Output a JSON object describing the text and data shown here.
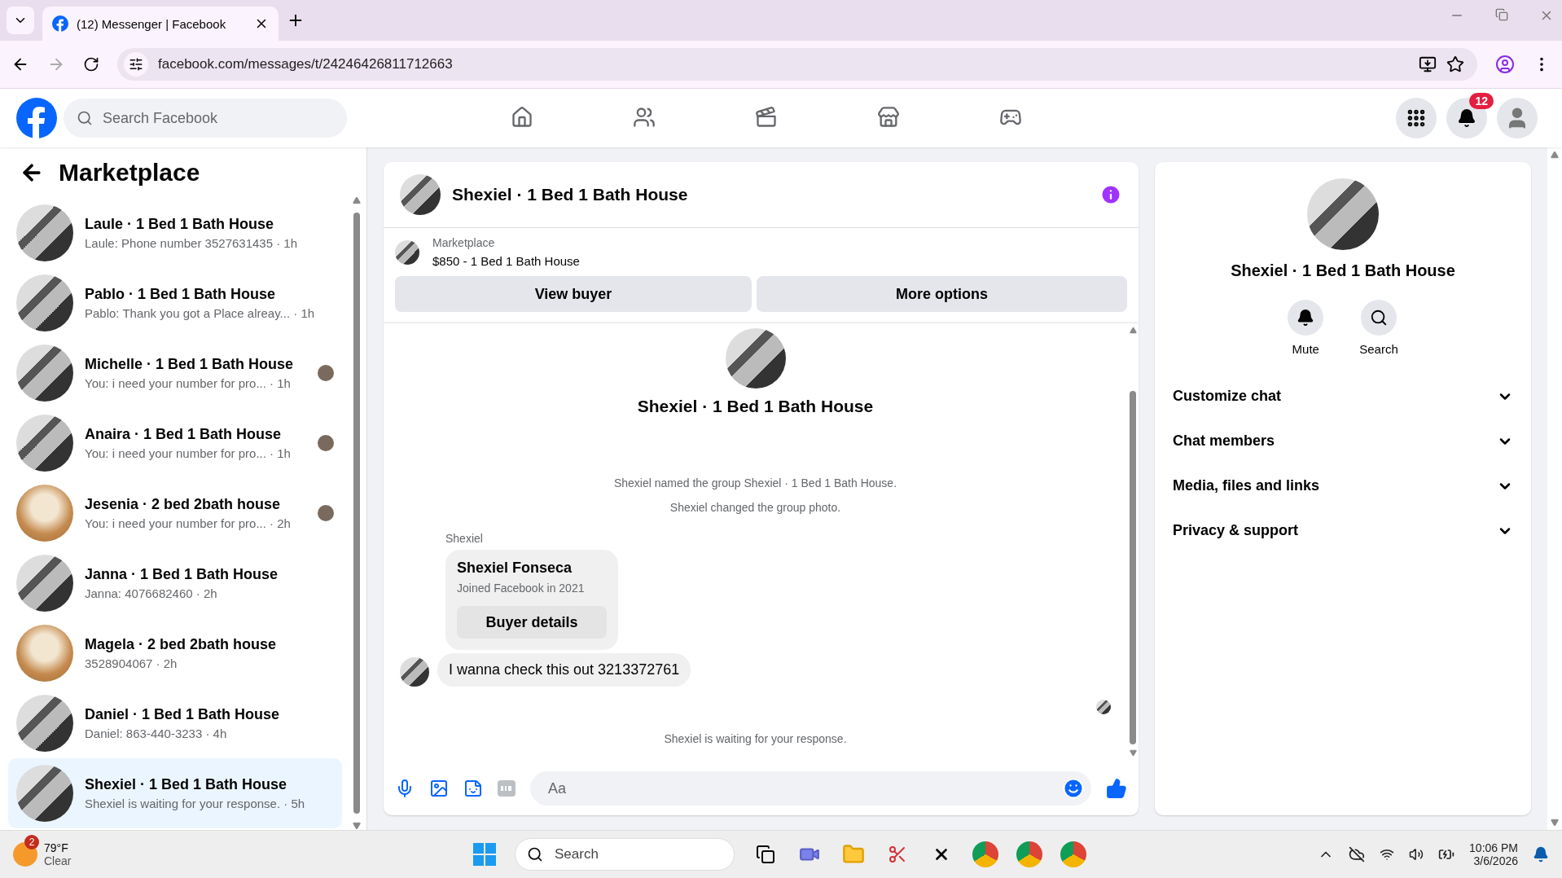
{
  "browser": {
    "tab_title": "(12) Messenger | Facebook",
    "url": "facebook.com/messages/t/24246426811712663"
  },
  "header": {
    "search_placeholder": "Search Facebook",
    "nav": [
      {
        "kind": "home",
        "selected": false
      },
      {
        "kind": "friends",
        "selected": false
      },
      {
        "kind": "video",
        "selected": false
      },
      {
        "kind": "marketplace",
        "selected": false
      },
      {
        "kind": "gaming",
        "selected": false
      }
    ],
    "notification_count": "12"
  },
  "sidebar": {
    "title": "Marketplace",
    "conversations": [
      {
        "title": "Laule · 1 Bed 1 Bath House",
        "preview": "Laule: Phone number 3527631435",
        "time": "· 1h",
        "kind": "kitchen",
        "seen": false,
        "selected": false
      },
      {
        "title": "Pablo · 1 Bed 1 Bath House",
        "preview": "Pablo: Thank you got a Place alreay...",
        "time": "· 1h",
        "kind": "kitchen",
        "seen": false,
        "selected": false
      },
      {
        "title": "Michelle · 1 Bed 1 Bath House",
        "preview": "You: i need your number for pro...",
        "time": "· 1h",
        "kind": "kitchen",
        "seen": true,
        "selected": false
      },
      {
        "title": "Anaira · 1 Bed 1 Bath House",
        "preview": "You: i need your number for pro...",
        "time": "· 1h",
        "kind": "kitchen",
        "seen": true,
        "selected": false
      },
      {
        "title": "Jesenia · 2 bed 2bath house",
        "preview": "You: i need your number for pro...",
        "time": "· 2h",
        "kind": "wood",
        "seen": true,
        "selected": false
      },
      {
        "title": "Janna · 1 Bed 1 Bath House",
        "preview": "Janna: 4076682460",
        "time": "· 2h",
        "kind": "kitchen",
        "seen": false,
        "selected": false
      },
      {
        "title": "Magela · 2 bed 2bath house",
        "preview": "3528904067",
        "time": "· 2h",
        "kind": "wood",
        "seen": false,
        "selected": false
      },
      {
        "title": "Daniel · 1 Bed 1 Bath House",
        "preview": "Daniel: 863-440-3233",
        "time": "· 4h",
        "kind": "kitchen",
        "seen": false,
        "selected": false
      },
      {
        "title": "Shexiel · 1 Bed 1 Bath House",
        "preview": "Shexiel is waiting for your response.",
        "time": "· 5h",
        "kind": "kitchen",
        "seen": false,
        "selected": true
      }
    ]
  },
  "chat": {
    "title": "Shexiel · 1 Bed 1 Bath House",
    "listing": {
      "label": "Marketplace",
      "item": "$850 - 1 Bed 1 Bath House"
    },
    "buttons": [
      "View buyer",
      "More options"
    ],
    "intro_title": "Shexiel · 1 Bed 1 Bath House",
    "events": [
      "Shexiel named the group Shexiel · 1 Bed 1 Bath House.",
      "Shexiel changed the group photo."
    ],
    "sender": "Shexiel",
    "buyer_card": {
      "name": "Shexiel Fonseca",
      "joined": "Joined Facebook in 2021",
      "button": "Buyer details"
    },
    "message": "I wanna check this out 3213372761",
    "waiting": "Shexiel is waiting for your response.",
    "composer_placeholder": "Aa"
  },
  "details": {
    "title": "Shexiel · 1 Bed 1 Bath House",
    "actions": [
      {
        "kind": "mute",
        "label": "Mute"
      },
      {
        "kind": "search",
        "label": "Search"
      }
    ],
    "sections": [
      {
        "label": "Customize chat",
        "expanded": false
      },
      {
        "label": "Chat members",
        "expanded": false
      },
      {
        "label": "Media, files and links",
        "expanded": false
      },
      {
        "label": "Privacy & support",
        "expanded": false
      }
    ]
  },
  "taskbar": {
    "weather_badge": "2",
    "temperature": "79°F",
    "condition": "Clear",
    "search_placeholder": "Search",
    "time": "10:06 PM",
    "date": "3/6/2026"
  }
}
